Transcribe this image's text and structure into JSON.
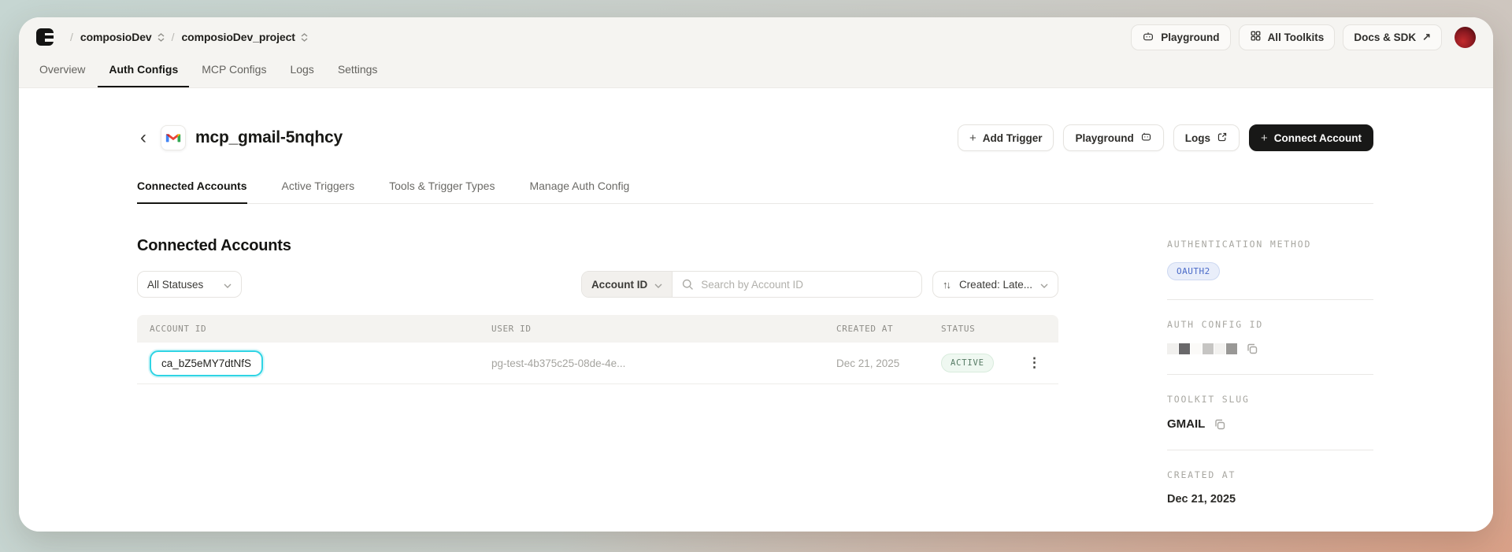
{
  "colors": {
    "bg-grad-start": "#c6d6d2",
    "bg-grad-mid": "#cbccc7",
    "bg-grad-end": "#db9f85",
    "accent-highlight": "#2fd4e4",
    "status-active-text": "#567a64",
    "status-active-bg": "#eff8f1",
    "oauth2-text": "#4a6ac8",
    "oauth2-bg": "#e9eefa",
    "primary-button-bg": "#181817"
  },
  "topbar": {
    "breadcrumb": {
      "separator": "/",
      "org": "composioDev",
      "project": "composioDev_project"
    },
    "playground_label": "Playground",
    "all_toolkits_label": "All Toolkits",
    "docs_sdk_label": "Docs & SDK"
  },
  "icons": {
    "docs_arrow": "↗",
    "back": "‹",
    "menu": "⋮",
    "sort": "↑↓"
  },
  "nav_tabs": [
    {
      "label": "Overview"
    },
    {
      "label": "Auth Configs"
    },
    {
      "label": "MCP Configs"
    },
    {
      "label": "Logs"
    },
    {
      "label": "Settings"
    }
  ],
  "page_header": {
    "title": "mcp_gmail-5nqhcy",
    "add_trigger_plus": "+",
    "add_trigger_label": "Add Trigger",
    "playground_label": "Playground",
    "logs_label": "Logs",
    "connect_plus": "+",
    "connect_account_label": "Connect Account"
  },
  "sub_tabs": [
    {
      "label": "Connected Accounts"
    },
    {
      "label": "Active Triggers"
    },
    {
      "label": "Tools & Trigger Types"
    },
    {
      "label": "Manage Auth Config"
    }
  ],
  "accounts_section": {
    "heading": "Connected Accounts",
    "status_filter_value": "All Statuses",
    "search_field_value": "Account ID",
    "search_placeholder": "Search by Account ID",
    "search_value": "",
    "sort_value": "Created: Late...",
    "table": {
      "headers": [
        "ACCOUNT ID",
        "USER ID",
        "CREATED AT",
        "STATUS"
      ],
      "rows": [
        {
          "account_id": "ca_bZ5eMY7dtNfS",
          "user_id": "pg-test-4b375c25-08de-4e...",
          "created_at": "Dec 21, 2025",
          "status": "ACTIVE"
        }
      ]
    }
  },
  "details_panel": {
    "auth_method_label": "AUTHENTICATION METHOD",
    "auth_method_value": "OAUTH2",
    "auth_config_id_label": "AUTH CONFIG ID",
    "auth_config_id_redacted": true,
    "toolkit_slug_label": "TOOLKIT SLUG",
    "toolkit_slug_value": "GMAIL",
    "created_at_label": "CREATED AT",
    "created_at_value": "Dec 21, 2025"
  }
}
